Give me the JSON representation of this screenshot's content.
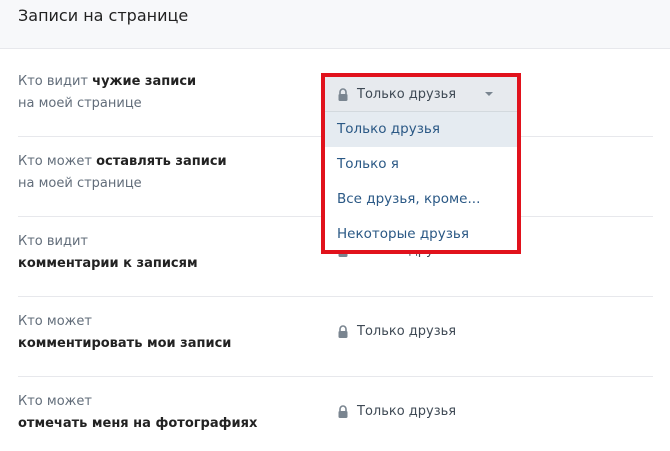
{
  "header": {
    "title": "Записи на странице"
  },
  "rows": [
    {
      "line1_prefix": "Кто видит ",
      "line1_bold": "чужие записи",
      "line2": "на моей странице",
      "value": "Только друзья"
    },
    {
      "line1_prefix": "Кто может ",
      "line1_bold": "оставлять записи",
      "line2": "на моей странице",
      "value": ""
    },
    {
      "line1_prefix": "Кто видит",
      "line1_bold": "",
      "line2_bold": "комментарии к записям",
      "value": "Только друзья"
    },
    {
      "line1_prefix": "Кто может",
      "line1_bold": "",
      "line2_bold": "комментировать мои записи",
      "value": "Только друзья"
    },
    {
      "line1_prefix": "Кто может",
      "line1_bold": "",
      "line2_bold": "отмечать меня на фотографиях",
      "value": "Только друзья"
    }
  ],
  "dropdown": {
    "selected": "Только друзья",
    "options": [
      "Только друзья",
      "Только я",
      "Все друзья, кроме...",
      "Некоторые друзья"
    ]
  },
  "colors": {
    "highlight": "#e1121c",
    "link": "#2a5885",
    "option_selected_bg": "#e5ebf1"
  }
}
